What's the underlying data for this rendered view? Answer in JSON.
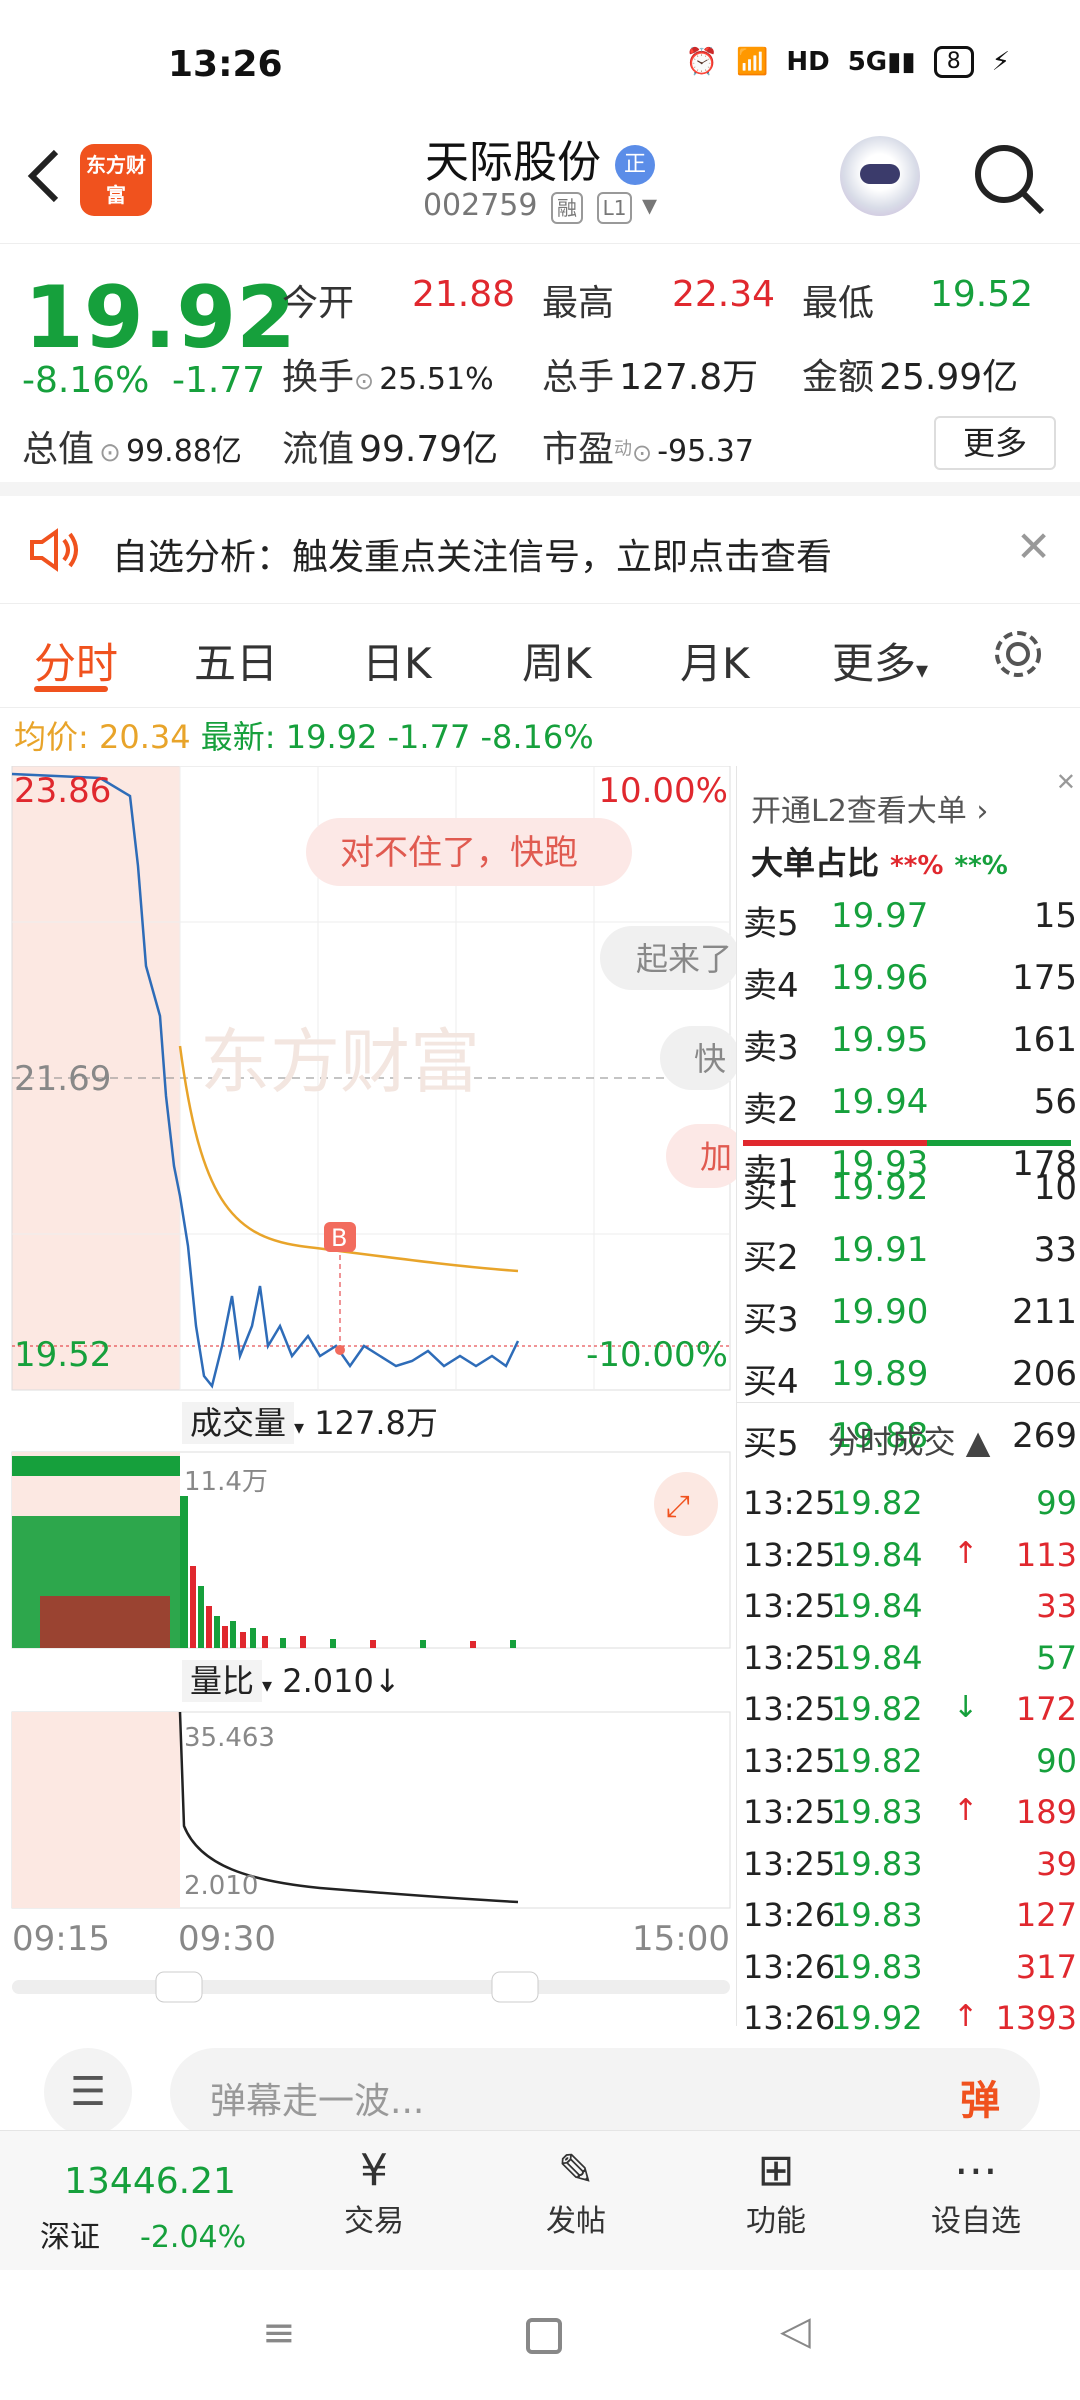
{
  "status": {
    "time": "13:26",
    "battery": "8"
  },
  "header": {
    "logo": "东方财富",
    "name": "天际股份",
    "badge": "正",
    "code": "002759",
    "tag1": "融",
    "tag2": "L1"
  },
  "quote": {
    "price": "19.92",
    "pct": "-8.16%",
    "chg": "-1.77",
    "open_label": "今开",
    "open": "21.88",
    "high_label": "最高",
    "high": "22.34",
    "low_label": "最低",
    "low": "19.52",
    "turn_label": "换手",
    "turn": "25.51%",
    "vol_label": "总手",
    "vol": "127.8万",
    "amt_label": "金额",
    "amt": "25.99亿",
    "mcap_label": "总值",
    "mcap": "99.88亿",
    "flow_label": "流值",
    "flow": "99.79亿",
    "pe_label": "市盈",
    "pe_sup": "动",
    "pe": "-95.37",
    "more": "更多"
  },
  "notice": {
    "text": "自选分析：触发重点关注信号，立即点击查看"
  },
  "tabs": [
    "分时",
    "五日",
    "日K",
    "周K",
    "月K",
    "更多"
  ],
  "summary": {
    "avg_label": "均价:",
    "avg": "20.34",
    "last_label": "最新:",
    "last": "19.92",
    "chg": "-1.77",
    "pct": "-8.16%"
  },
  "chart": {
    "y_top": "23.86",
    "y_mid": "21.69",
    "y_bot": "19.52",
    "pct_top": "10.00%",
    "pct_bot": "-10.00%",
    "danmu": [
      "对不住了，快跑",
      "起来了",
      "快",
      "加"
    ],
    "watermark": "东方财富",
    "b_marker": "B",
    "vol_label": "成交量",
    "vol_total": "127.8万",
    "vol_max": "11.4万",
    "ratio_label": "量比",
    "ratio_val": "2.010",
    "ratio_arrow": "↓",
    "ratio_max": "35.463",
    "ratio_min": "2.010",
    "times": [
      "09:15",
      "09:30",
      "15:00"
    ]
  },
  "orderbook": {
    "promo": "开通L2查看大单",
    "big_label": "大单占比",
    "big_sell": "**%",
    "big_buy": "**%",
    "sells": [
      {
        "l": "卖5",
        "p": "19.97",
        "v": "15"
      },
      {
        "l": "卖4",
        "p": "19.96",
        "v": "175"
      },
      {
        "l": "卖3",
        "p": "19.95",
        "v": "161"
      },
      {
        "l": "卖2",
        "p": "19.94",
        "v": "56"
      },
      {
        "l": "卖1",
        "p": "19.93",
        "v": "178"
      }
    ],
    "buys": [
      {
        "l": "买1",
        "p": "19.92",
        "v": "10"
      },
      {
        "l": "买2",
        "p": "19.91",
        "v": "33"
      },
      {
        "l": "买3",
        "p": "19.90",
        "v": "211"
      },
      {
        "l": "买4",
        "p": "19.89",
        "v": "206"
      },
      {
        "l": "买5",
        "p": "19.88",
        "v": "269"
      }
    ],
    "ticks_label": "分时成交",
    "ticks": [
      {
        "t": "13:25",
        "p": "19.82",
        "a": "",
        "v": "99"
      },
      {
        "t": "13:25",
        "p": "19.84",
        "a": "↑",
        "v": "113"
      },
      {
        "t": "13:25",
        "p": "19.84",
        "a": "",
        "v": "33"
      },
      {
        "t": "13:25",
        "p": "19.84",
        "a": "",
        "v": "57"
      },
      {
        "t": "13:25",
        "p": "19.82",
        "a": "↓",
        "v": "172"
      },
      {
        "t": "13:25",
        "p": "19.82",
        "a": "",
        "v": "90"
      },
      {
        "t": "13:25",
        "p": "19.83",
        "a": "↑",
        "v": "189"
      },
      {
        "t": "13:25",
        "p": "19.83",
        "a": "",
        "v": "39"
      },
      {
        "t": "13:26",
        "p": "19.83",
        "a": "",
        "v": "127"
      },
      {
        "t": "13:26",
        "p": "19.83",
        "a": "",
        "v": "317"
      },
      {
        "t": "13:26",
        "p": "19.92",
        "a": "↑",
        "v": "1393"
      }
    ]
  },
  "input": {
    "placeholder": "弹幕走一波...",
    "btn": "弹"
  },
  "bottom": {
    "index": "13446.21",
    "index_name": "深证",
    "index_pct": "-2.04%",
    "items": [
      "交易",
      "发帖",
      "功能",
      "设自选"
    ]
  }
}
